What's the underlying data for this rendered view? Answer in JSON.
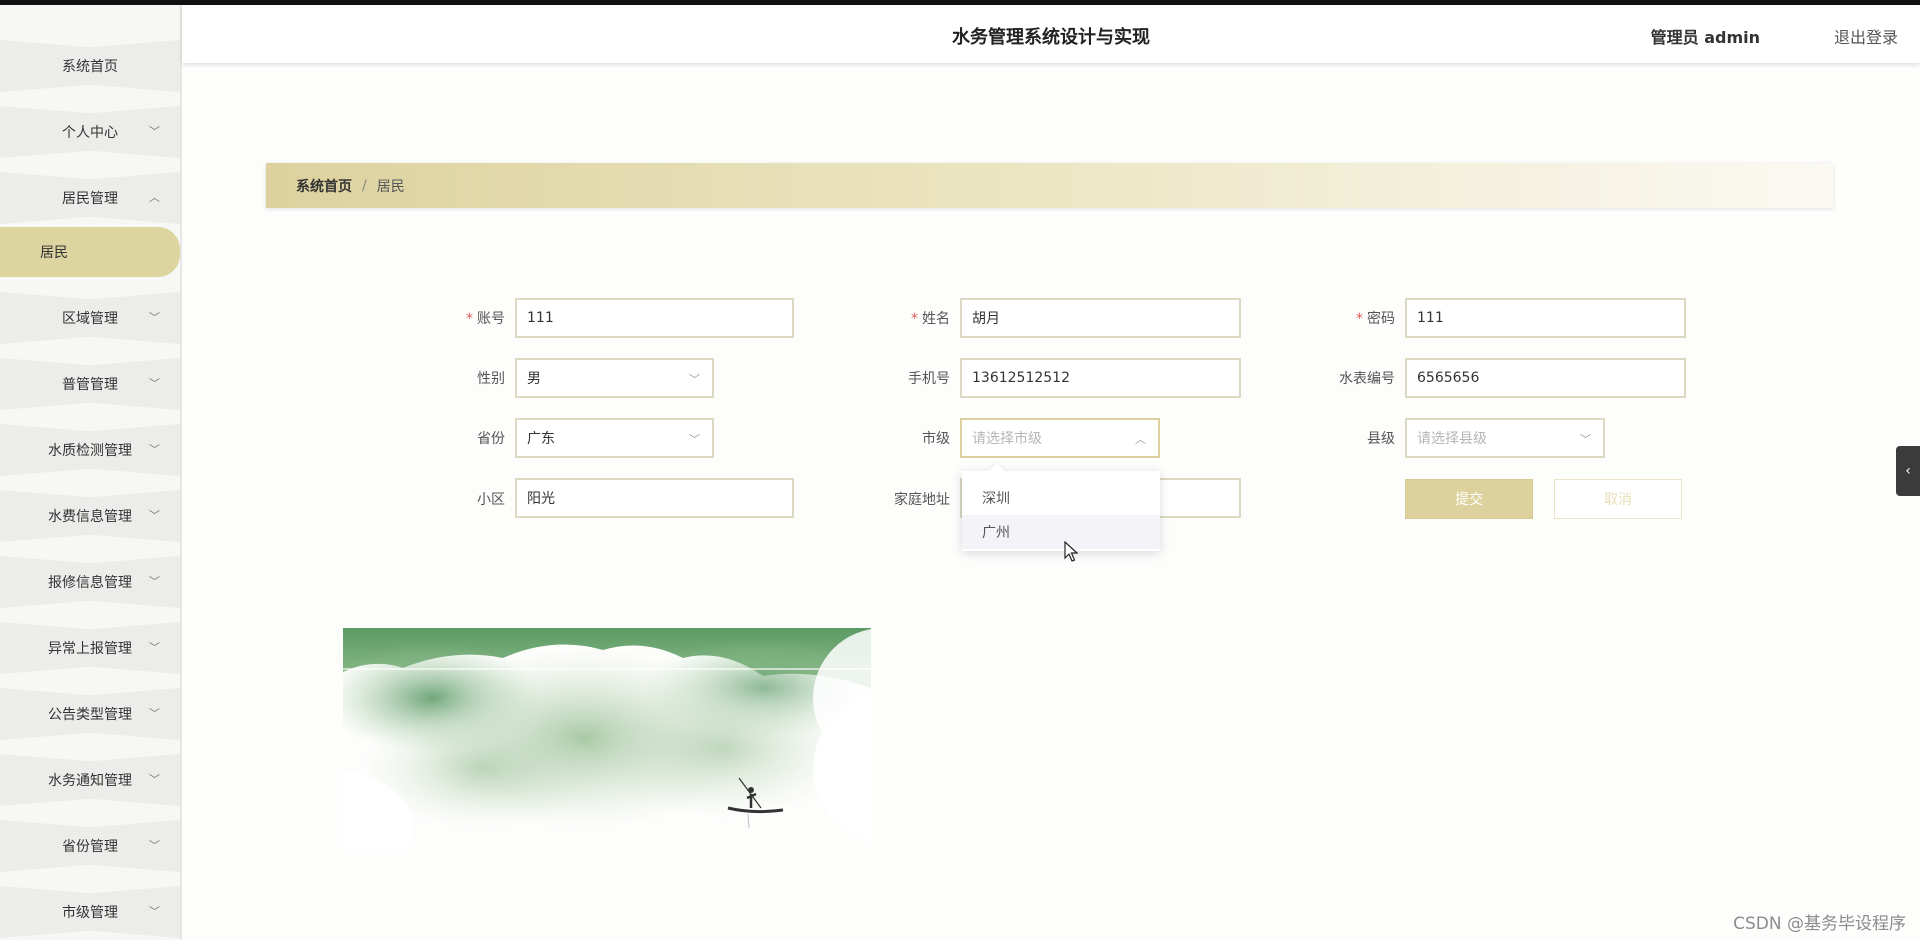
{
  "header": {
    "title": "水务管理系统设计与实现",
    "user": "管理员 admin",
    "logout": "退出登录"
  },
  "sidebar": {
    "items": [
      {
        "label": "系统首页",
        "has_chevron": false
      },
      {
        "label": "个人中心",
        "has_chevron": true
      },
      {
        "label": "居民管理",
        "has_chevron": true,
        "expanded": true
      },
      {
        "label": "居民",
        "active": true
      },
      {
        "label": "区域管理",
        "has_chevron": true
      },
      {
        "label": "普管管理",
        "has_chevron": true
      },
      {
        "label": "水质检测管理",
        "has_chevron": true
      },
      {
        "label": "水费信息管理",
        "has_chevron": true
      },
      {
        "label": "报修信息管理",
        "has_chevron": true
      },
      {
        "label": "异常上报管理",
        "has_chevron": true
      },
      {
        "label": "公告类型管理",
        "has_chevron": true
      },
      {
        "label": "水务通知管理",
        "has_chevron": true
      },
      {
        "label": "省份管理",
        "has_chevron": true
      },
      {
        "label": "市级管理",
        "has_chevron": true
      }
    ],
    "chevron_down": "﹀",
    "chevron_up": "︿"
  },
  "breadcrumb": {
    "home": "系统首页",
    "separator": "/",
    "current": "居民"
  },
  "form": {
    "account": {
      "label": "账号",
      "value": "111",
      "required": true
    },
    "name": {
      "label": "姓名",
      "value": "胡月",
      "required": true
    },
    "password": {
      "label": "密码",
      "value": "111",
      "required": true
    },
    "gender": {
      "label": "性别",
      "value": "男"
    },
    "phone": {
      "label": "手机号",
      "value": "13612512512"
    },
    "meter": {
      "label": "水表编号",
      "value": "6565656"
    },
    "province": {
      "label": "省份",
      "value": "广东"
    },
    "city": {
      "label": "市级",
      "placeholder": "请选择市级",
      "open": true
    },
    "county": {
      "label": "县级",
      "placeholder": "请选择县级"
    },
    "community": {
      "label": "小区",
      "value": "阳光"
    },
    "address": {
      "label": "家庭地址",
      "value": ""
    },
    "required_mark": "*",
    "submit": "提交",
    "cancel": "取消"
  },
  "city_dropdown": {
    "options": [
      "深圳",
      "广州"
    ],
    "hovered_index": 1
  },
  "drawer_toggle": "‹",
  "watermark": "CSDN @基务毕设程序",
  "colors": {
    "accent": "#ddd29e",
    "active_menu": "#ddd5a0",
    "required": "#e05a5a"
  }
}
